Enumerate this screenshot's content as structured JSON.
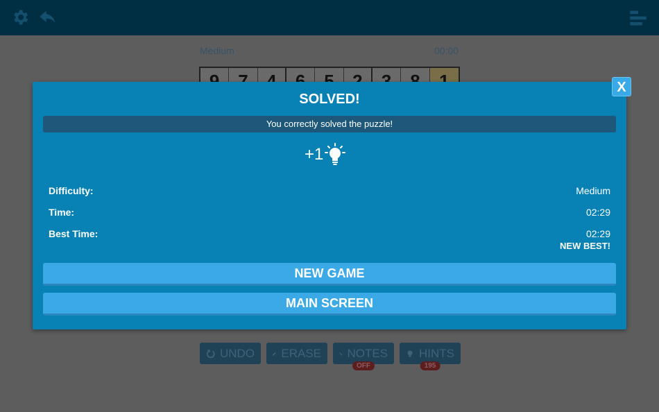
{
  "topbar": {
    "settings_icon": "gear-icon",
    "undo_icon": "back-arrow-icon",
    "menu_icon": "menu-icon"
  },
  "game": {
    "difficulty": "Medium",
    "timer": "00:00",
    "board_row": [
      "9",
      "7",
      "4",
      "6",
      "5",
      "2",
      "3",
      "8",
      "1"
    ]
  },
  "bottom_bar": {
    "undo_label": "UNDO",
    "erase_label": "ERASE",
    "notes_label": "NOTES",
    "notes_badge": "OFF",
    "hints_label": "HINTS",
    "hints_badge": "195"
  },
  "modal": {
    "close_label": "X",
    "title": "SOLVED!",
    "message": "You correctly solved the puzzle!",
    "reward": "+1",
    "reward_icon": "lightbulb-icon",
    "rows": {
      "difficulty_label": "Difficulty:",
      "difficulty_value": "Medium",
      "time_label": "Time:",
      "time_value": "02:29",
      "best_label": "Best Time:",
      "best_value": "02:29",
      "best_note": "NEW BEST!"
    },
    "new_game_label": "NEW GAME",
    "main_screen_label": "MAIN SCREEN"
  },
  "colors": {
    "modal_bg": "#0881b5",
    "button_bg": "#3ba9e6",
    "topbar_bg": "#002e43"
  }
}
